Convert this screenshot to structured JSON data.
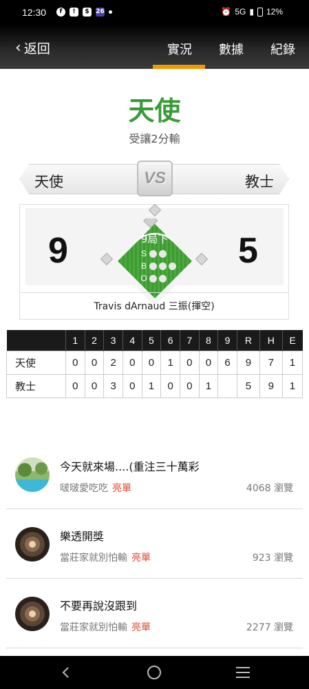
{
  "status": {
    "time": "12:30",
    "network": "5G",
    "battery": "12%"
  },
  "header": {
    "back_label": "返回",
    "tabs": [
      {
        "label": "實況"
      },
      {
        "label": "數據"
      },
      {
        "label": "紀錄"
      }
    ],
    "active_tab_color": "#f39800"
  },
  "result": {
    "winner": "天使",
    "subtitle": "受讓2分輸",
    "winner_color": "#3a9a3a"
  },
  "matchup": {
    "away_team": "天使",
    "home_team": "教士",
    "vs_label": "VS",
    "away_score": "9",
    "home_score": "5",
    "inning": "9局下",
    "count": {
      "labels": [
        "S",
        "B",
        "O"
      ],
      "strikes_shown": 2,
      "balls_shown": 3,
      "outs_shown": 2
    },
    "last_play": "Travis dArnaud 三振(揮空)"
  },
  "linescore": {
    "headers": [
      "1",
      "2",
      "3",
      "4",
      "5",
      "6",
      "7",
      "8",
      "9",
      "R",
      "H",
      "E"
    ],
    "rows": [
      {
        "team": "天使",
        "cells": [
          "0",
          "0",
          "2",
          "0",
          "0",
          "1",
          "0",
          "0",
          "6",
          "9",
          "7",
          "1"
        ]
      },
      {
        "team": "教士",
        "cells": [
          "0",
          "0",
          "3",
          "0",
          "1",
          "0",
          "0",
          "1",
          "",
          "5",
          "9",
          "1"
        ]
      }
    ]
  },
  "posts": [
    {
      "title": "今天就來場....(重注三十萬彩",
      "author": "啵啵愛吃吃",
      "tag": "亮單",
      "views": "4068 瀏覽",
      "avatar": "pool-photo"
    },
    {
      "title": "樂透開獎",
      "author": "當莊家就別怕輸",
      "tag": "亮單",
      "views": "923 瀏覽",
      "avatar": "tunnel-photo"
    },
    {
      "title": "不要再說沒跟到",
      "author": "當莊家就別怕輸",
      "tag": "亮單",
      "views": "2277 瀏覽",
      "avatar": "tunnel-photo"
    }
  ],
  "nav": {
    "icons": [
      "back-icon",
      "home-icon",
      "recents-icon"
    ]
  }
}
